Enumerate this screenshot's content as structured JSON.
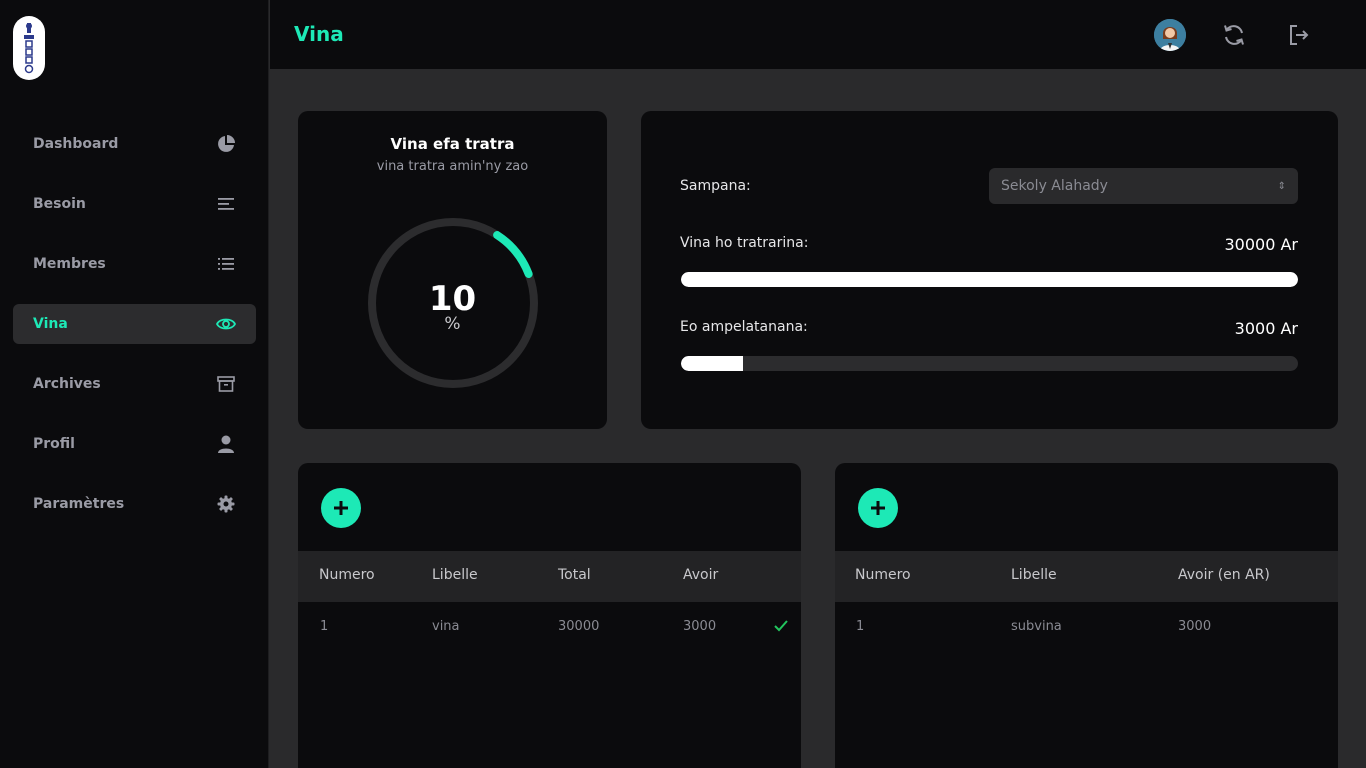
{
  "app": {
    "logo_icon": "app-logo"
  },
  "sidebar": {
    "items": [
      {
        "label": "Dashboard",
        "icon": "pie-chart-icon",
        "active": false
      },
      {
        "label": "Besoin",
        "icon": "align-left-icon",
        "active": false
      },
      {
        "label": "Membres",
        "icon": "list-icon",
        "active": false
      },
      {
        "label": "Vina",
        "icon": "eye-icon",
        "active": true
      },
      {
        "label": "Archives",
        "icon": "archive-icon",
        "active": false
      },
      {
        "label": "Profil",
        "icon": "user-icon",
        "active": false
      },
      {
        "label": "Paramètres",
        "icon": "gear-icon",
        "active": false
      }
    ]
  },
  "header": {
    "title": "Vina",
    "icons": [
      "avatar",
      "refresh-icon",
      "logout-icon"
    ]
  },
  "gauge_card": {
    "title": "Vina efa tratra",
    "subtitle": "vina tratra amin'ny zao",
    "value": "10",
    "unit": "%",
    "percent": 10
  },
  "progress_card": {
    "sampana_label": "Sampana:",
    "sampana_value": "Sekoly Alahady",
    "target_label": "Vina ho tratrarina:",
    "target_amount": "30000 Ar",
    "target_fraction": 1.0,
    "current_label": "Eo ampelatanana:",
    "current_amount": "3000 Ar",
    "current_fraction": 0.1
  },
  "table_left": {
    "headers": [
      "Numero",
      "Libelle",
      "Total",
      "Avoir"
    ],
    "rows": [
      {
        "numero": "1",
        "libelle": "vina",
        "total": "30000",
        "avoir": "3000",
        "checked": true
      }
    ]
  },
  "table_right": {
    "headers": [
      "Numero",
      "Libelle",
      "Avoir (en AR)"
    ],
    "rows": [
      {
        "numero": "1",
        "libelle": "subvina",
        "avoir": "3000"
      }
    ]
  },
  "colors": {
    "accent": "#1de9b6",
    "background": "#2a2a2c",
    "panel": "#0b0b0d",
    "muted_text": "#9a9ba5"
  }
}
